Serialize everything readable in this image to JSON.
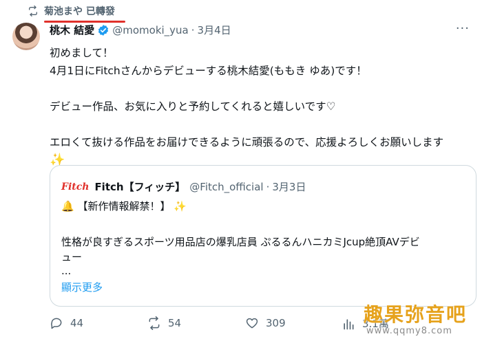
{
  "retweet": {
    "label": "菊池まや 已轉發"
  },
  "tweet": {
    "display_name": "桃木 結愛",
    "handle": "@momoki_yua",
    "separator": "·",
    "date": "3月4日",
    "more": "···",
    "lines": [
      "初めまして！",
      "4月1日にFitchさんからデビューする桃木結愛(ももき ゆあ)です！",
      "デビュー作品、お気に入りと予約してくれると嬉しいです♡",
      "エロくて抜ける作品をお届けできるように頑張るので、応援よろしくお願いします",
      "✨"
    ]
  },
  "quote": {
    "logo": "Fitch",
    "display_name": "Fitch【フィッチ】",
    "handle": "@Fitch_official",
    "separator": "·",
    "date": "3月3日",
    "line1_emoji": "🔔",
    "line1_text": "【新作情報解禁！】",
    "line1_sparkle": "✨",
    "line2": "性格が良すぎるスポーツ用品店の爆乳店員 ぷるるんハニカミJcup絶頂AVデビ",
    "line3": "ュー",
    "line4": "...",
    "show_more": "顯示更多"
  },
  "actions": {
    "replies": "44",
    "retweets": "54",
    "likes": "309",
    "views": "3.1萬"
  },
  "watermark": {
    "title": "趣果弥音吧",
    "url": "www.qqmy8.com"
  },
  "colors": {
    "accent_blue": "#1d9bf0",
    "muted": "#536471",
    "border": "#cfd9de",
    "underline_red": "#e0302b"
  }
}
